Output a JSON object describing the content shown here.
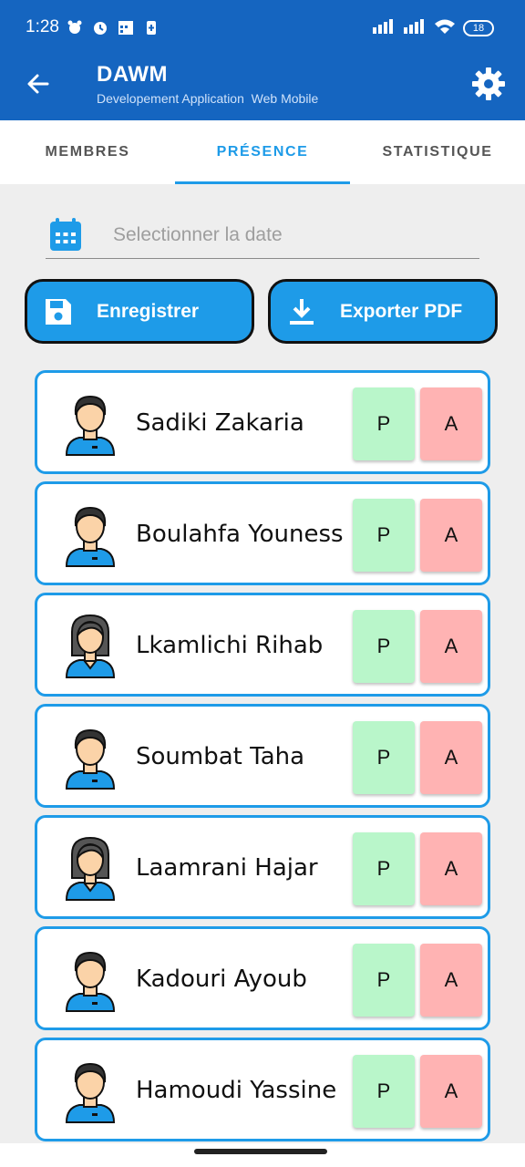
{
  "status_bar": {
    "time": "1:28",
    "battery": "18"
  },
  "app_bar": {
    "title": "DAWM",
    "subtitle": "Developement Application  Web Mobile"
  },
  "tabs": [
    {
      "label": "MEMBRES",
      "active": false
    },
    {
      "label": "PRÉSENCE",
      "active": true
    },
    {
      "label": "STATISTIQUE",
      "active": false
    }
  ],
  "date_picker": {
    "placeholder": "Selectionner la date"
  },
  "actions": {
    "save_label": "Enregistrer",
    "export_label": "Exporter PDF"
  },
  "attendance": {
    "present_label": "P",
    "absent_label": "A",
    "members": [
      {
        "name": "Sadiki Zakaria",
        "avatar": "male-avatar-icon"
      },
      {
        "name": "Boulahfa Youness",
        "avatar": "male-avatar-icon"
      },
      {
        "name": "Lkamlichi Rihab",
        "avatar": "female-avatar-icon"
      },
      {
        "name": "Soumbat Taha",
        "avatar": "male-avatar-icon"
      },
      {
        "name": "Laamrani Hajar",
        "avatar": "female-avatar-icon"
      },
      {
        "name": "Kadouri Ayoub",
        "avatar": "male-avatar-icon"
      },
      {
        "name": "Hamoudi Yassine",
        "avatar": "male-avatar-icon"
      }
    ]
  },
  "colors": {
    "primary": "#1565c0",
    "accent": "#1e9be8",
    "present": "#b9f6ca",
    "absent": "#ffb3b3"
  }
}
